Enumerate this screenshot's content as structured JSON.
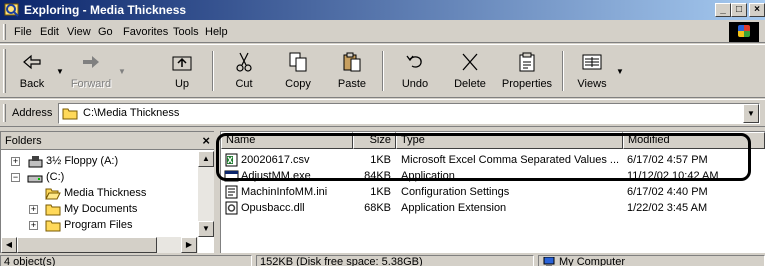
{
  "window": {
    "title": "Exploring - Media Thickness"
  },
  "menu": [
    "File",
    "Edit",
    "View",
    "Go",
    "Favorites",
    "Tools",
    "Help"
  ],
  "toolbar": {
    "back": "Back",
    "forward": "Forward",
    "up": "Up",
    "cut": "Cut",
    "copy": "Copy",
    "paste": "Paste",
    "undo": "Undo",
    "delete": "Delete",
    "properties": "Properties",
    "views": "Views"
  },
  "address": {
    "label": "Address",
    "value": "C:\\Media Thickness"
  },
  "folders": {
    "header": "Folders",
    "items": [
      {
        "label": "3½ Floppy (A:)",
        "icon": "floppy-drive-icon"
      },
      {
        "label": "(C:)",
        "icon": "hard-drive-icon"
      },
      {
        "label": "Media Thickness",
        "icon": "open-folder-icon"
      },
      {
        "label": "My Documents",
        "icon": "folder-icon"
      },
      {
        "label": "Program Files",
        "icon": "folder-icon"
      }
    ]
  },
  "filelist": {
    "columns": {
      "name": "Name",
      "size": "Size",
      "type": "Type",
      "modified": "Modified"
    },
    "rows": [
      {
        "name": "20020617.csv",
        "size": "1KB",
        "type": "Microsoft Excel Comma Separated Values ...",
        "modified": "6/17/02 4:57 PM",
        "icon": "excel-csv-icon"
      },
      {
        "name": "AdjustMM.exe",
        "size": "84KB",
        "type": "Application",
        "modified": "11/12/02 10:42 AM",
        "icon": "application-icon"
      },
      {
        "name": "MachinInfoMM.ini",
        "size": "1KB",
        "type": "Configuration Settings",
        "modified": "6/17/02 4:40 PM",
        "icon": "ini-file-icon"
      },
      {
        "name": "Opusbacc.dll",
        "size": "68KB",
        "type": "Application Extension",
        "modified": "1/22/02 3:45 AM",
        "icon": "dll-file-icon"
      }
    ]
  },
  "status": {
    "objects": "4 object(s)",
    "space": "152KB (Disk free space: 5.38GB)",
    "location": "My Computer"
  }
}
